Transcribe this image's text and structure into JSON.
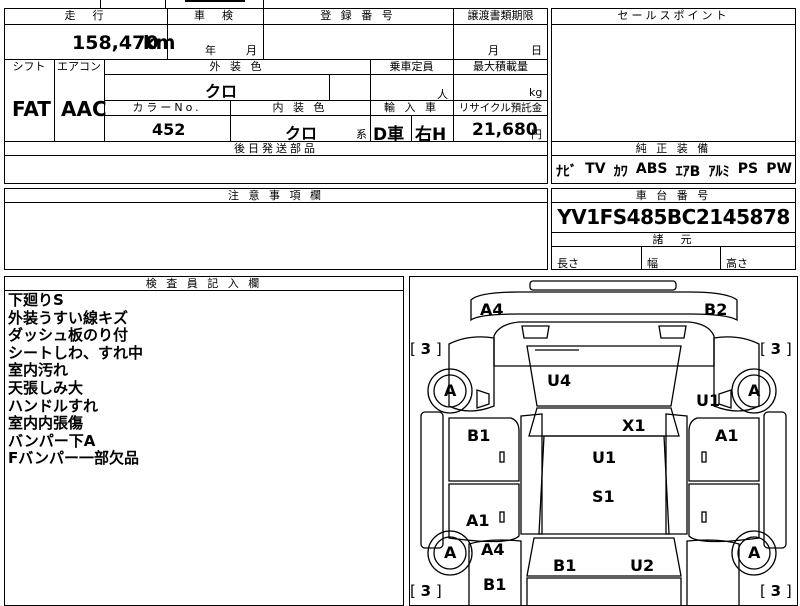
{
  "header": {
    "mileage_label": "走　行",
    "mileage_value": "158,470",
    "mileage_unit": "km",
    "inspection_label": "車　検",
    "inspection_year_unit": "年",
    "inspection_month_unit": "月",
    "registration_label": "登 録 番 号",
    "transfer_label": "譲渡書類期限",
    "transfer_month_unit": "月",
    "transfer_day_unit": "日",
    "sales_point_label": "セールスポイント"
  },
  "specs": {
    "shift_label": "シフト",
    "shift_value": "FAT",
    "aircon_label": "エアコン",
    "aircon_value": "AAC",
    "exterior_label": "外 装 色",
    "exterior_value": "クロ",
    "capacity_label": "乗車定員",
    "capacity_unit": "人",
    "max_load_label": "最大積載量",
    "max_load_unit": "kg",
    "color_no_label": "カラーNo.",
    "color_no_value": "452",
    "interior_label": "内 装 色",
    "interior_value": "クロ",
    "interior_suffix": "系",
    "import_label": "輸 入 車",
    "import_d": "D車",
    "import_steer": "右H",
    "recycle_label": "リサイクル預託金",
    "recycle_value": "21,680",
    "recycle_unit": "円",
    "later_parts_label": "後日発送部品"
  },
  "equipment": {
    "label": "純 正 装 備",
    "items": [
      "ﾅﾋﾞ",
      "TV",
      "ｶﾜ",
      "ABS",
      "ｴｱB",
      "ｱﾙﾐ",
      "PS",
      "PW"
    ]
  },
  "caution_label": "注 意 事 項 欄",
  "chassis": {
    "label": "車 台 番 号",
    "value": "YV1FS485BC2145878",
    "dims_label": "諸　元",
    "length_label": "長さ",
    "width_label": "幅",
    "height_label": "高さ"
  },
  "inspector": {
    "label": "検 査 員 記 入 欄",
    "notes": [
      "下廻りS",
      "外装うすい線キズ",
      "ダッシュ板のり付",
      "シートしわ、すれ中",
      "室内汚れ",
      "天張しみ大",
      "ハンドルすれ",
      "室内内張傷",
      "バンパー下A",
      "Fバンパー一部欠品"
    ]
  },
  "diagram": {
    "labels": {
      "front_left": "A4",
      "front_right": "B2",
      "windshield": "U4",
      "front_right_fender": "U1",
      "left_front_door": "B1",
      "roof_front": "X1",
      "right_front_door": "A1",
      "roof": "U1",
      "roof_rear": "S1",
      "left_rear_door": "A1",
      "left_rear_fender": "A4",
      "rear_left": "B1",
      "rear_trunk": "B1",
      "rear_right": "U2"
    },
    "tires": {
      "fl": "A",
      "fr": "A",
      "rl": "A",
      "rr": "A"
    },
    "tire_depth": {
      "fl": "3",
      "fr": "3",
      "rl": "3",
      "rr": "3"
    }
  }
}
